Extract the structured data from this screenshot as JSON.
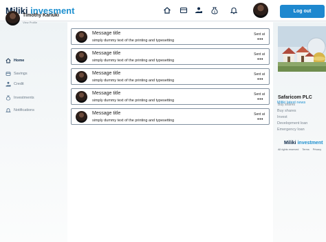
{
  "brand": {
    "word1": "Miliki",
    "word2": "invesment"
  },
  "header": {
    "logout_label": "Log out"
  },
  "profile": {
    "name": "Timothy Kariuki",
    "sub": "View Profile"
  },
  "sidebar": {
    "items": [
      {
        "label": "Home",
        "icon": "home-icon"
      },
      {
        "label": "Savings",
        "icon": "savings-icon"
      },
      {
        "label": "Credit",
        "icon": "credit-icon"
      },
      {
        "label": "Investments",
        "icon": "investments-icon"
      },
      {
        "label": "Notifications",
        "icon": "notifications-icon"
      }
    ]
  },
  "messages": [
    {
      "title": "Message title",
      "body": "simply dummy text of the printing and typesetting",
      "sent": "Sent at",
      "menu": "•••"
    },
    {
      "title": "Message title",
      "body": "simply dummy text of the printing and typesetting",
      "sent": "Sent at",
      "menu": "•••"
    },
    {
      "title": "Message title",
      "body": "simply dummy text of the printing and typesetting",
      "sent": "Sent at",
      "menu": "•••"
    },
    {
      "title": "Message title",
      "body": "simply dummy text of the printing and typesetting",
      "sent": "Sent at",
      "menu": "•••"
    },
    {
      "title": "Message title",
      "body": "simply dummy text of the printing and typesetting",
      "sent": "Sent at",
      "menu": "•••"
    }
  ],
  "promo": {
    "title": "Safaricom PLC",
    "sub": "Buy shares"
  },
  "news": {
    "heading": "Miliki latest news",
    "items": [
      "Buy shares",
      "Invest",
      "Development loan",
      "Emergency loan"
    ]
  },
  "footer": {
    "brand1": "Miliki",
    "brand2": "investment",
    "links": [
      "All rights reserved",
      "Terms",
      "Privacy"
    ]
  },
  "colors": {
    "accent": "#1e88cf",
    "brand_dark": "#0e2a4a"
  }
}
